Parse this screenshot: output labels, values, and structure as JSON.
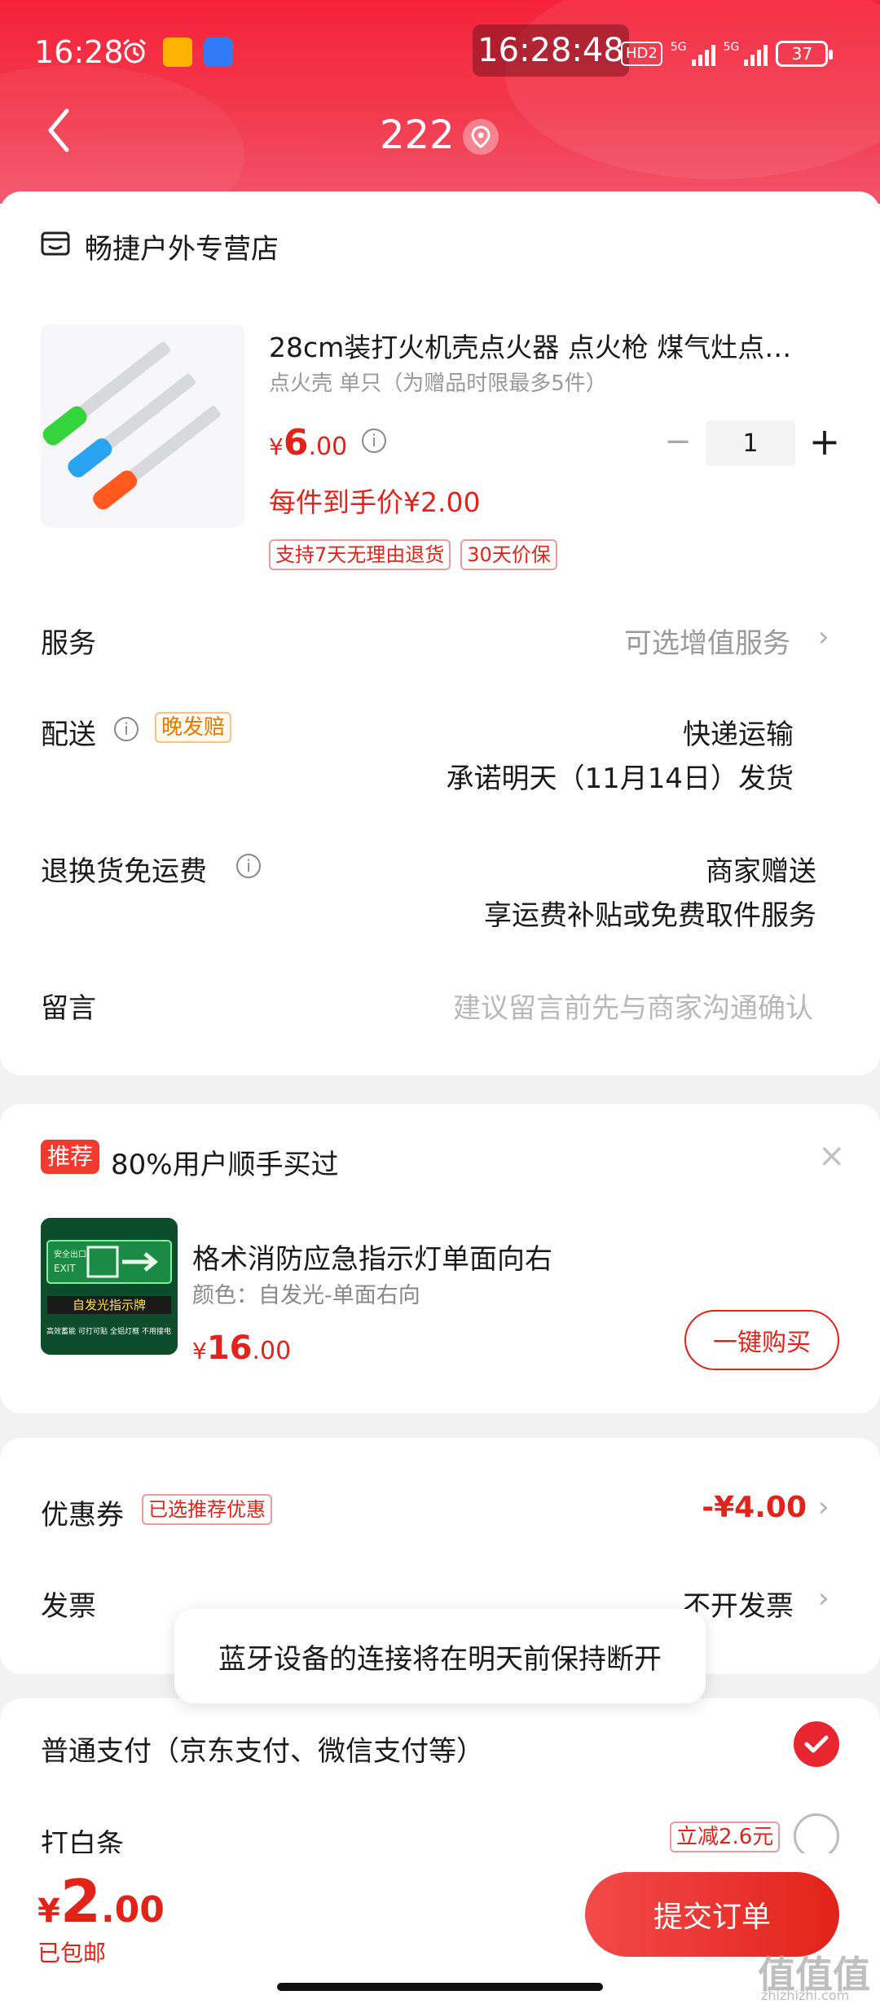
{
  "status_bar": {
    "time": "16:28",
    "center_time": "16:28:48",
    "hd_label": "HD2",
    "net1": "5G",
    "net2": "5G",
    "battery": "37"
  },
  "header": {
    "title": "222"
  },
  "store": {
    "name": "畅捷户外专营店"
  },
  "product": {
    "title": "28cm装打火机壳点火器 点火枪 煤气灶点…",
    "spec": "点火壳 单只（为赠品时限最多5件）",
    "price_symbol": "¥",
    "price_int": "6",
    "price_dec": ".00",
    "per_item_price": "每件到手价¥2.00",
    "quantity": "1",
    "tags": [
      "支持7天无理由退货",
      "30天价保"
    ]
  },
  "rows": {
    "service_label": "服务",
    "service_value": "可选增值服务",
    "delivery_label": "配送",
    "delivery_tag": "晚发赔",
    "delivery_value1": "快递运输",
    "delivery_value2": "承诺明天（11月14日）发货",
    "return_label": "退换货免运费",
    "return_value1": "商家赠送",
    "return_value2": "享运费补贴或免费取件服务",
    "message_label": "留言",
    "message_placeholder": "建议留言前先与商家沟通确认"
  },
  "recommend": {
    "badge": "推荐",
    "title": "80%用户顺手买过",
    "item_name": "格术消防应急指示灯单面向右",
    "item_spec": "颜色：自发光-单面右向",
    "price_symbol": "¥",
    "price_int": "16",
    "price_dec": ".00",
    "buy_label": "一键购买",
    "img_top_text": "安全出口",
    "img_exit": "EXIT",
    "img_banner": "自发光指示牌",
    "img_features": [
      "高效蓄能",
      "可打可贴",
      "全铝灯框",
      "不用接电"
    ]
  },
  "discount": {
    "coupon_label": "优惠券",
    "coupon_tag": "已选推荐优惠",
    "coupon_value": "-¥4.00",
    "invoice_label": "发票",
    "invoice_value": "不开发票"
  },
  "toast": {
    "text": "蓝牙设备的连接将在明天前保持断开"
  },
  "payment": {
    "normal_label": "普通支付（京东支付、微信支付等）",
    "baitiao_label": "打白条",
    "baitiao_tag": "立减2.6元"
  },
  "bottom": {
    "total_symbol": "¥",
    "total_int": "2",
    "total_dec": ".00",
    "shipping": "已包邮",
    "submit": "提交订单"
  },
  "watermark": {
    "text": "值值值",
    "sub": "zhizhizhi.com"
  },
  "colors": {
    "brand_red": "#e2231a",
    "header_red": "#f5223a"
  }
}
